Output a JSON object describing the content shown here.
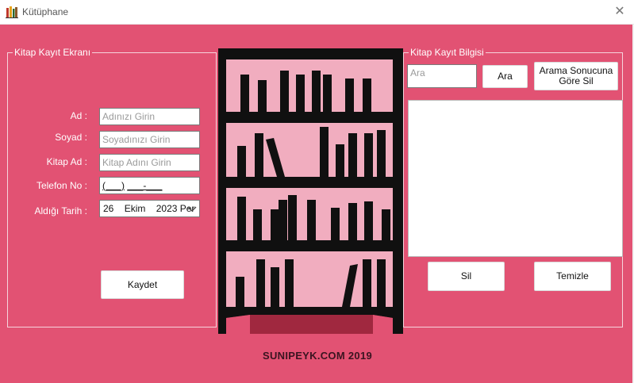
{
  "window": {
    "title": "Kütüphane",
    "close_glyph": "✕",
    "icon": "books-icon"
  },
  "left_group": {
    "title": "Kitap Kayıt Ekranı",
    "labels": {
      "ad": "Ad :",
      "soyad": "Soyad :",
      "kitap_ad": "Kitap Ad :",
      "telefon": "Telefon No :",
      "tarih": "Aldığı Tarih :"
    },
    "placeholders": {
      "ad": "Adınızı Girin",
      "soyad": "Soyadınızı Girin",
      "kitap_ad": "Kitap Adını Girin"
    },
    "telefon_mask": {
      "part1": "(___)",
      "part2": "___-___"
    },
    "date": {
      "day": "26",
      "month": "Ekim",
      "year": "2023 Per"
    },
    "save_button": "Kaydet"
  },
  "right_group": {
    "title": "Kitap Kayıt Bilgisi",
    "search_placeholder": "Ara",
    "search_button": "Ara",
    "delete_by_search_button": "Arama Sonucuna Göre Sil",
    "delete_button": "Sil",
    "clear_button": "Temizle"
  },
  "bookshelf": {
    "shelf_color": "#101010",
    "back_color": "#f1adbf",
    "floor_color": "#a0283f"
  },
  "footer": {
    "text": "SUNIPEYK.COM 2019"
  },
  "colors": {
    "background": "#e25273",
    "group_border": "#f6d4dc"
  }
}
